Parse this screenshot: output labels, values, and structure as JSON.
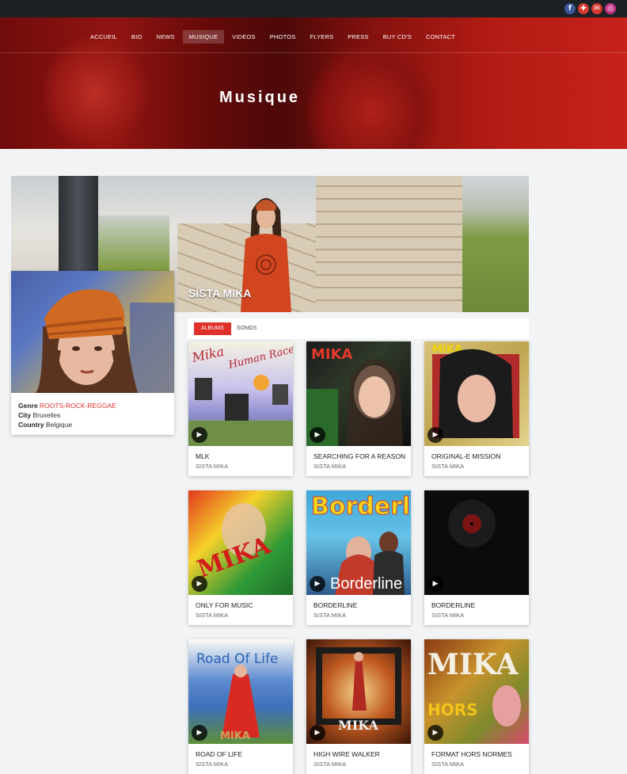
{
  "social": {
    "icons": [
      "facebook-icon",
      "share-icon",
      "mail-icon",
      "instagram-icon"
    ],
    "colors": [
      "#3b5998",
      "#d63a2f",
      "#d63a2f",
      "#c13584"
    ]
  },
  "nav": {
    "items": [
      "ACCUEIL",
      "BIO",
      "NEWS",
      "MUSIQUE",
      "VIDEOS",
      "PHOTOS",
      "FLYERS",
      "PRESS",
      "BUY CD'S",
      "CONTACT"
    ],
    "active": "MUSIQUE"
  },
  "hero": {
    "title": "Musique"
  },
  "artist": {
    "name": "SISTA MIKA",
    "genre_label": "Genre",
    "genre_value": "ROOTS-ROCK-REGGAE",
    "city_label": "City",
    "city_value": "Bruxelles",
    "country_label": "Country",
    "country_value": "Belgique"
  },
  "tabs": {
    "albums": "ALBUMS",
    "songs": "SONGS",
    "active": "ALBUMS"
  },
  "albums": [
    {
      "title": "MLK",
      "artist": "SISTA MIKA",
      "cover_text": ""
    },
    {
      "title": "SEARCHING FOR A REASON",
      "artist": "SISTA MIKA",
      "cover_text": "MIKA"
    },
    {
      "title": "ORIGINAL-E MISSION",
      "artist": "SISTA MIKA",
      "cover_text": "MIKA"
    },
    {
      "title": "ONLY FOR MUSIC",
      "artist": "SISTA MIKA",
      "cover_text": "MIKA"
    },
    {
      "title": "BORDERLINE",
      "artist": "SISTA MIKA",
      "cover_text": "Borderline"
    },
    {
      "title": "BORDERLINE",
      "artist": "SISTA MIKA",
      "cover_text": ""
    },
    {
      "title": "ROAD OF LIFE",
      "artist": "SISTA MIKA",
      "cover_text": "Road Of Life"
    },
    {
      "title": "HIGH WIRE WALKER",
      "artist": "SISTA MIKA",
      "cover_text": "MIKA"
    },
    {
      "title": "FORMAT HORS NORMES",
      "artist": "SISTA MIKA",
      "cover_text": "MIKA"
    }
  ],
  "colors": {
    "accent": "#e0302a",
    "topbar": "#1c2126"
  }
}
